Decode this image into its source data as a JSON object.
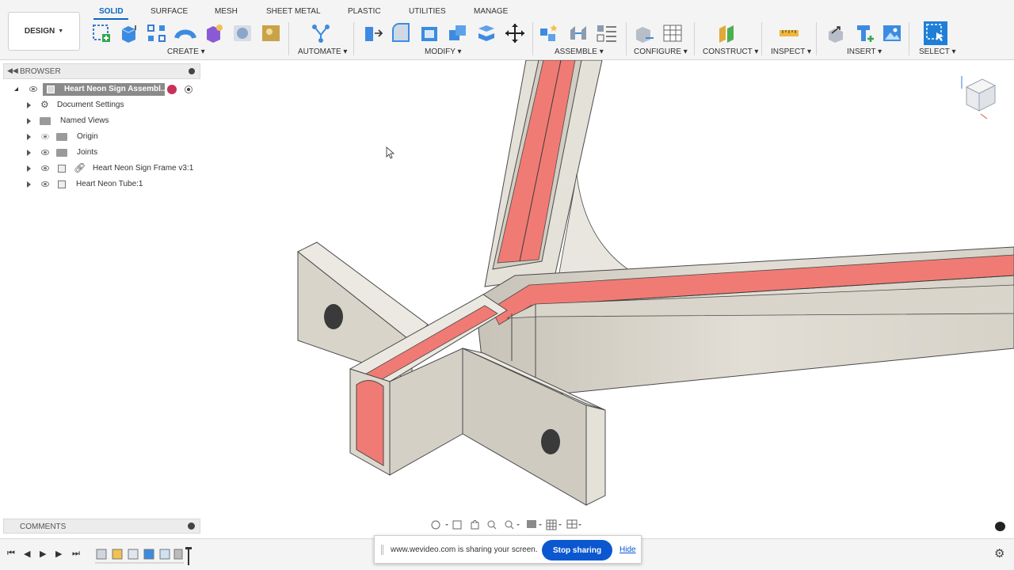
{
  "workspace": {
    "design_label": "DESIGN"
  },
  "tabs": [
    {
      "label": "SOLID",
      "active": true
    },
    {
      "label": "SURFACE"
    },
    {
      "label": "MESH"
    },
    {
      "label": "SHEET METAL"
    },
    {
      "label": "PLASTIC"
    },
    {
      "label": "UTILITIES"
    },
    {
      "label": "MANAGE"
    }
  ],
  "groups": {
    "create": "CREATE",
    "automate": "AUTOMATE",
    "modify": "MODIFY",
    "assemble": "ASSEMBLE",
    "configure": "CONFIGURE",
    "construct": "CONSTRUCT",
    "inspect": "INSPECT",
    "insert": "INSERT",
    "select": "SELECT"
  },
  "browser": {
    "title": "BROWSER",
    "root": "Heart Neon Sign Assembl...",
    "items": [
      {
        "label": "Document Settings",
        "icon": "gear-icon"
      },
      {
        "label": "Named Views",
        "icon": "folder-icon"
      },
      {
        "label": "Origin",
        "icon": "folder-icon",
        "hidden": true
      },
      {
        "label": "Joints",
        "icon": "folder-icon"
      },
      {
        "label": "Heart Neon Sign Frame v3:1",
        "icon": "component-link-icon"
      },
      {
        "label": "Heart Neon Tube:1",
        "icon": "component-icon"
      }
    ]
  },
  "comments": {
    "label": "COMMENTS"
  },
  "share": {
    "message": "www.wevideo.com is sharing your screen.",
    "stop_label": "Stop sharing",
    "hide_label": "Hide"
  },
  "colors": {
    "accent": "#0a66c2",
    "model_body": "#e4e1d9",
    "neon_tube": "#f07b74",
    "share_button": "#0b57d0"
  }
}
